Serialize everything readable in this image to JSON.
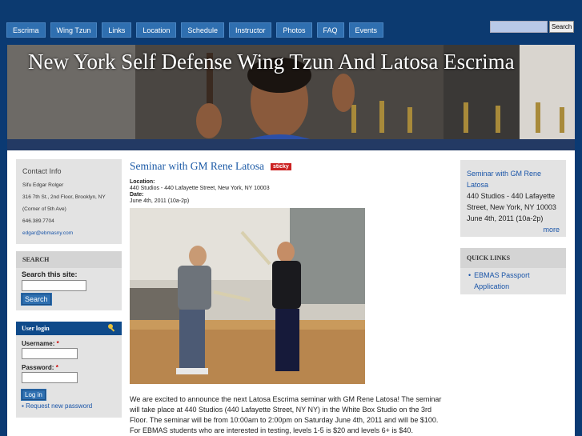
{
  "nav": [
    "Escrima",
    "Wing Tzun",
    "Links",
    "Location",
    "Schedule",
    "Instructor",
    "Photos",
    "FAQ",
    "Events"
  ],
  "search": {
    "placeholder": "",
    "button": "Search"
  },
  "site_title": "New York Self Defense Wing Tzun And Latosa Escrima",
  "contact": {
    "heading": "Contact Info",
    "lines": [
      "Sifu Edgar Rolger",
      "316 7th St., 2nd Floor, Brooklyn, NY",
      "(Corner of 5th Ave)",
      "646.389.7704"
    ],
    "email": "edgar@ebmasny.com"
  },
  "site_search": {
    "heading": "SEARCH",
    "label": "Search this site:",
    "button": "Search"
  },
  "login": {
    "heading": "User login",
    "username": "Username:",
    "password": "Password:",
    "required": "*",
    "button": "Log in",
    "request": "Request new password"
  },
  "post": {
    "title": "Seminar with GM Rene Latosa",
    "badge": "sticky",
    "location_label": "Location:",
    "location": "440 Studios - 440 Lafayette Street, New York, NY 10003",
    "date_label": "Date:",
    "date": "June 4th, 2011 (10a-2p)",
    "body": "We are excited to announce the next Latosa Escrima seminar with GM Rene Latosa! The seminar will take place at 440 Studios (440 Lafayette Street, NY NY) in the White Box Studio on the 3rd Floor. The seminar will be from 10:00am to 2:00pm on Saturday June 4th, 2011 and will be $100. For EBMAS students who are interested in testing, levels 1-5 is $20 and levels 6+ is $40."
  },
  "event": {
    "title": "Seminar with GM Rene Latosa",
    "location": "440 Studios - 440 Lafayette Street, New York, NY 10003",
    "date": "June 4th, 2011 (10a-2p)",
    "more": "more"
  },
  "quick": {
    "heading": "QUICK LINKS",
    "item": "EBMAS Passport Application"
  },
  "colors": {
    "nav_bg": "#2f6fb0",
    "header_bg": "#0c3a70",
    "link": "#1a55a8",
    "sticky": "#cc2222"
  }
}
